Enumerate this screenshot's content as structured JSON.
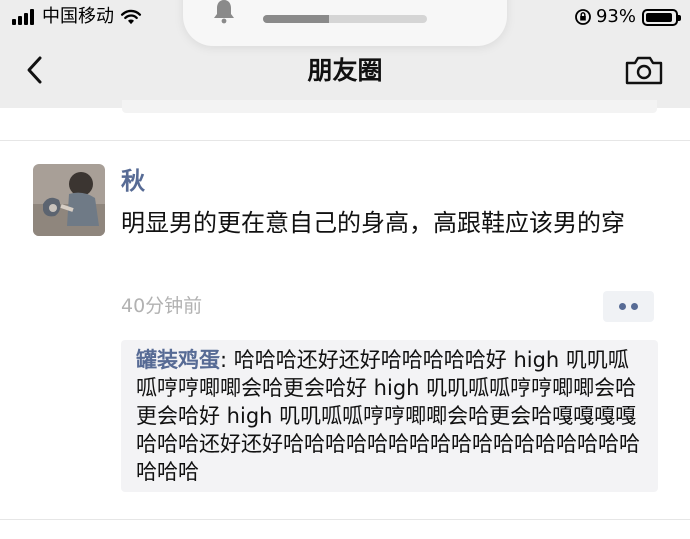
{
  "status_bar": {
    "carrier": "中国移动",
    "battery_percent": "93%",
    "battery_level": 0.93
  },
  "volume_hud": {
    "level": 0.4
  },
  "nav": {
    "title": "朋友圈",
    "back_icon": "chevron-left-icon",
    "camera_icon": "camera-icon"
  },
  "post": {
    "author": "秋",
    "content": "明显男的更在意自己的身高，高跟鞋应该男的穿",
    "time": "40分钟前",
    "more_icon": "more-dots-icon",
    "comments": [
      {
        "commenter": "罐装鸡蛋",
        "separator": ": ",
        "text": "哈哈哈还好还好哈哈哈哈哈好 high 叽叽呱呱哼哼唧唧会哈更会哈好 high 叽叽呱呱哼哼唧唧会哈更会哈好 high 叽叽呱呱哼哼唧唧会哈更会哈嘎嘎嘎嘎哈哈哈还好还好哈哈哈哈哈哈哈哈哈哈哈哈哈哈哈哈哈哈哈哈"
      }
    ]
  },
  "colors": {
    "link": "#576b95",
    "nav_bg": "#ededed",
    "time_gray": "#b2b2b2"
  }
}
